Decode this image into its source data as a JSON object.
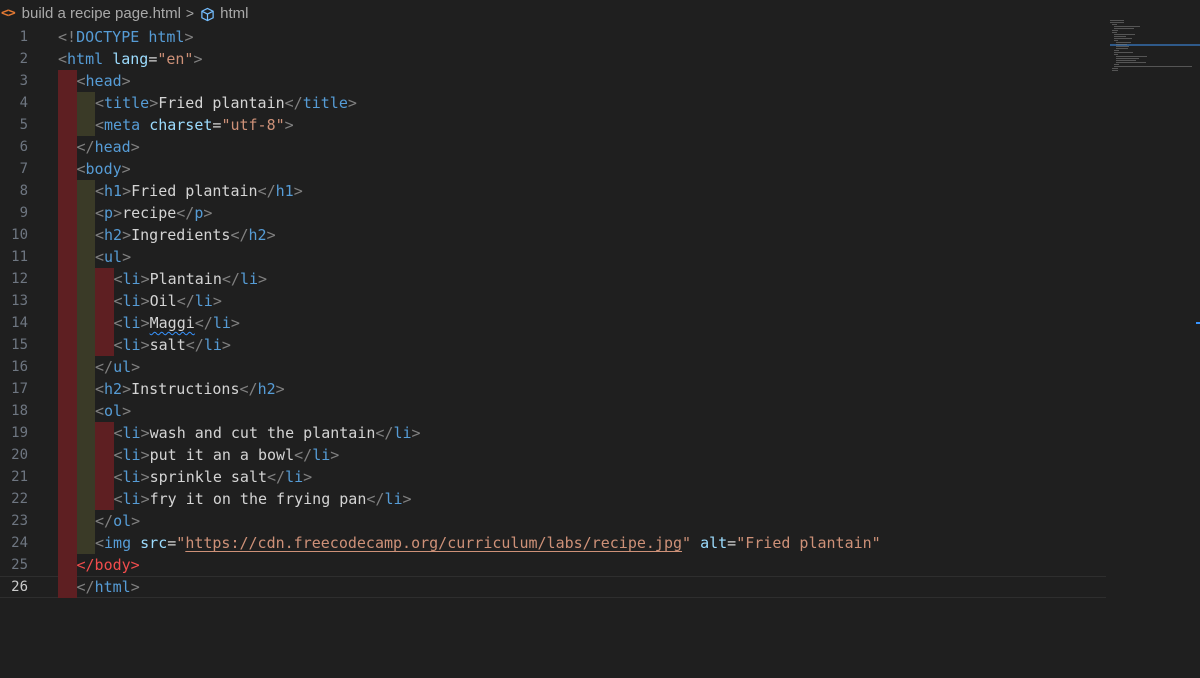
{
  "breadcrumb": {
    "file_icon": "<>",
    "file": "build a recipe page.html",
    "separator": ">",
    "symbol_icon": "cube-icon",
    "symbol": "html"
  },
  "editor": {
    "current_line": 26,
    "lines": [
      {
        "n": "1",
        "tokens": [
          [
            "br",
            "<!"
          ],
          [
            "doctype",
            "DOCTYPE "
          ],
          [
            "tag",
            "html"
          ],
          [
            "br",
            ">"
          ]
        ]
      },
      {
        "n": "2",
        "tokens": [
          [
            "br",
            "<"
          ],
          [
            "tag",
            "html "
          ],
          [
            "attr",
            "lang"
          ],
          [
            "text",
            "="
          ],
          [
            "val",
            "\"en\""
          ],
          [
            "br",
            ">"
          ]
        ]
      },
      {
        "n": "3",
        "tokens": [
          [
            "br",
            "<"
          ],
          [
            "tag",
            "head"
          ],
          [
            "br",
            ">"
          ]
        ]
      },
      {
        "n": "4",
        "tokens": [
          [
            "br",
            "<"
          ],
          [
            "tag",
            "title"
          ],
          [
            "br",
            ">"
          ],
          [
            "text",
            "Fried plantain"
          ],
          [
            "br",
            "</"
          ],
          [
            "tag",
            "title"
          ],
          [
            "br",
            ">"
          ]
        ]
      },
      {
        "n": "5",
        "tokens": [
          [
            "br",
            "<"
          ],
          [
            "tag",
            "meta "
          ],
          [
            "attr",
            "charset"
          ],
          [
            "text",
            "="
          ],
          [
            "val",
            "\"utf-8\""
          ],
          [
            "br",
            ">"
          ]
        ]
      },
      {
        "n": "6",
        "tokens": [
          [
            "br",
            "</"
          ],
          [
            "tag",
            "head"
          ],
          [
            "br",
            ">"
          ]
        ]
      },
      {
        "n": "7",
        "tokens": [
          [
            "br",
            "<"
          ],
          [
            "tag",
            "body"
          ],
          [
            "br",
            ">"
          ]
        ]
      },
      {
        "n": "8",
        "tokens": [
          [
            "br",
            "<"
          ],
          [
            "tag",
            "h1"
          ],
          [
            "br",
            ">"
          ],
          [
            "text",
            "Fried plantain"
          ],
          [
            "br",
            "</"
          ],
          [
            "tag",
            "h1"
          ],
          [
            "br",
            ">"
          ]
        ]
      },
      {
        "n": "9",
        "tokens": [
          [
            "br",
            "<"
          ],
          [
            "tag",
            "p"
          ],
          [
            "br",
            ">"
          ],
          [
            "text",
            "recipe"
          ],
          [
            "br",
            "</"
          ],
          [
            "tag",
            "p"
          ],
          [
            "br",
            ">"
          ]
        ]
      },
      {
        "n": "10",
        "tokens": [
          [
            "br",
            "<"
          ],
          [
            "tag",
            "h2"
          ],
          [
            "br",
            ">"
          ],
          [
            "text",
            "Ingredients"
          ],
          [
            "br",
            "</"
          ],
          [
            "tag",
            "h2"
          ],
          [
            "br",
            ">"
          ]
        ]
      },
      {
        "n": "11",
        "tokens": [
          [
            "br",
            "<"
          ],
          [
            "tag",
            "ul"
          ],
          [
            "br",
            ">"
          ]
        ]
      },
      {
        "n": "12",
        "tokens": [
          [
            "br",
            "<"
          ],
          [
            "tag",
            "li"
          ],
          [
            "br",
            ">"
          ],
          [
            "text",
            "Plantain"
          ],
          [
            "br",
            "</"
          ],
          [
            "tag",
            "li"
          ],
          [
            "br",
            ">"
          ]
        ]
      },
      {
        "n": "13",
        "tokens": [
          [
            "br",
            "<"
          ],
          [
            "tag",
            "li"
          ],
          [
            "br",
            ">"
          ],
          [
            "text",
            "Oil"
          ],
          [
            "br",
            "</"
          ],
          [
            "tag",
            "li"
          ],
          [
            "br",
            ">"
          ]
        ]
      },
      {
        "n": "14",
        "tokens": [
          [
            "br",
            "<"
          ],
          [
            "tag",
            "li"
          ],
          [
            "br",
            ">"
          ],
          [
            "squig",
            "Maggi"
          ],
          [
            "br",
            "</"
          ],
          [
            "tag",
            "li"
          ],
          [
            "br",
            ">"
          ]
        ]
      },
      {
        "n": "15",
        "tokens": [
          [
            "br",
            "<"
          ],
          [
            "tag",
            "li"
          ],
          [
            "br",
            ">"
          ],
          [
            "text",
            "salt"
          ],
          [
            "br",
            "</"
          ],
          [
            "tag",
            "li"
          ],
          [
            "br",
            ">"
          ]
        ]
      },
      {
        "n": "16",
        "tokens": [
          [
            "br",
            "</"
          ],
          [
            "tag",
            "ul"
          ],
          [
            "br",
            ">"
          ]
        ]
      },
      {
        "n": "17",
        "tokens": [
          [
            "br",
            "<"
          ],
          [
            "tag",
            "h2"
          ],
          [
            "br",
            ">"
          ],
          [
            "text",
            "Instructions"
          ],
          [
            "br",
            "</"
          ],
          [
            "tag",
            "h2"
          ],
          [
            "br",
            ">"
          ]
        ]
      },
      {
        "n": "18",
        "tokens": [
          [
            "br",
            "<"
          ],
          [
            "tag",
            "ol"
          ],
          [
            "br",
            ">"
          ]
        ]
      },
      {
        "n": "19",
        "tokens": [
          [
            "br",
            "<"
          ],
          [
            "tag",
            "li"
          ],
          [
            "br",
            ">"
          ],
          [
            "text",
            "wash and cut the plantain"
          ],
          [
            "br",
            "</"
          ],
          [
            "tag",
            "li"
          ],
          [
            "br",
            ">"
          ]
        ]
      },
      {
        "n": "20",
        "tokens": [
          [
            "br",
            "<"
          ],
          [
            "tag",
            "li"
          ],
          [
            "br",
            ">"
          ],
          [
            "text",
            "put it an a bowl"
          ],
          [
            "br",
            "</"
          ],
          [
            "tag",
            "li"
          ],
          [
            "br",
            ">"
          ]
        ]
      },
      {
        "n": "21",
        "tokens": [
          [
            "br",
            "<"
          ],
          [
            "tag",
            "li"
          ],
          [
            "br",
            ">"
          ],
          [
            "text",
            "sprinkle salt"
          ],
          [
            "br",
            "</"
          ],
          [
            "tag",
            "li"
          ],
          [
            "br",
            ">"
          ]
        ]
      },
      {
        "n": "22",
        "tokens": [
          [
            "br",
            "<"
          ],
          [
            "tag",
            "li"
          ],
          [
            "br",
            ">"
          ],
          [
            "text",
            "fry it on the frying pan"
          ],
          [
            "br",
            "</"
          ],
          [
            "tag",
            "li"
          ],
          [
            "br",
            ">"
          ]
        ]
      },
      {
        "n": "23",
        "tokens": [
          [
            "br",
            "</"
          ],
          [
            "tag",
            "ol"
          ],
          [
            "br",
            ">"
          ]
        ]
      },
      {
        "n": "24",
        "tokens": [
          [
            "br",
            "<"
          ],
          [
            "tag",
            "img "
          ],
          [
            "attr",
            "src"
          ],
          [
            "text",
            "="
          ],
          [
            "val",
            "\""
          ],
          [
            "link",
            "https://cdn.freecodecamp.org/curriculum/labs/recipe.jpg"
          ],
          [
            "val",
            "\""
          ],
          [
            "text",
            " "
          ],
          [
            "attr",
            "alt"
          ],
          [
            "text",
            "="
          ],
          [
            "val",
            "\"Fried plantain\""
          ]
        ]
      },
      {
        "n": "25",
        "tokens": [
          [
            "err",
            "</body>"
          ]
        ]
      },
      {
        "n": "26",
        "tokens": [
          [
            "br",
            "</"
          ],
          [
            "tag",
            "html"
          ],
          [
            "br",
            ">"
          ]
        ]
      }
    ]
  },
  "colors": {
    "background": "#1f1f1f",
    "guide_error": "#5e1f22",
    "guide_normal": "#3a3a27",
    "tag": "#569cd6",
    "attribute": "#9cdcfe",
    "string": "#ce9178",
    "error": "#f14c4c"
  }
}
